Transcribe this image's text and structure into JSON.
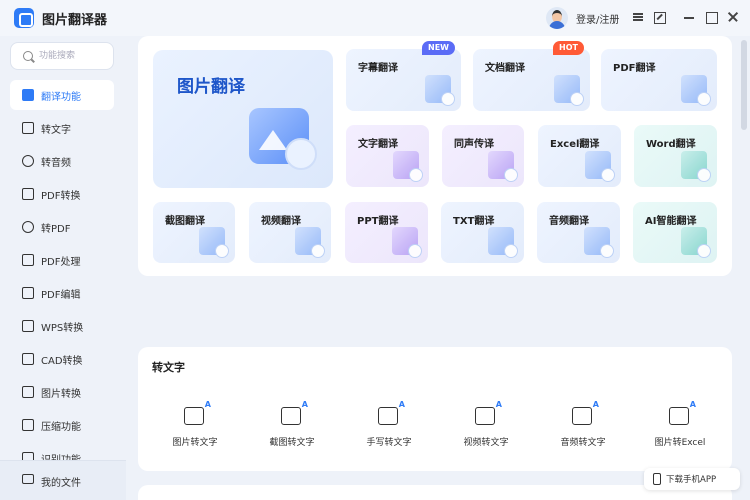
{
  "app": {
    "title": "图片翻译器",
    "login": "登录/注册"
  },
  "sidebar": {
    "search_placeholder": "功能搜索",
    "items": [
      {
        "label": "翻译功能",
        "active": true
      },
      {
        "label": "转文字"
      },
      {
        "label": "转音频"
      },
      {
        "label": "PDF转换"
      },
      {
        "label": "转PDF"
      },
      {
        "label": "PDF处理"
      },
      {
        "label": "PDF编辑"
      },
      {
        "label": "WPS转换"
      },
      {
        "label": "CAD转换"
      },
      {
        "label": "图片转换"
      },
      {
        "label": "压缩功能"
      },
      {
        "label": "识别功能"
      }
    ],
    "footer": "我的文件"
  },
  "translate": {
    "hero_title": "图片翻译",
    "row1": [
      {
        "label": "字幕翻译",
        "badge": "NEW"
      },
      {
        "label": "文档翻译",
        "badge": "HOT"
      },
      {
        "label": "PDF翻译"
      }
    ],
    "row2": [
      {
        "label": "文字翻译"
      },
      {
        "label": "同声传译"
      },
      {
        "label": "Excel翻译"
      },
      {
        "label": "Word翻译"
      }
    ],
    "row3": [
      {
        "label": "截图翻译"
      },
      {
        "label": "视频翻译"
      },
      {
        "label": "PPT翻译"
      },
      {
        "label": "TXT翻译"
      },
      {
        "label": "音频翻译"
      },
      {
        "label": "AI智能翻译"
      }
    ]
  },
  "to_text": {
    "title": "转文字",
    "tools": [
      {
        "label": "图片转文字"
      },
      {
        "label": "截图转文字"
      },
      {
        "label": "手写转文字"
      },
      {
        "label": "视频转文字"
      },
      {
        "label": "音频转文字"
      },
      {
        "label": "图片转Excel"
      }
    ]
  },
  "download": {
    "label": "下载手机APP"
  }
}
